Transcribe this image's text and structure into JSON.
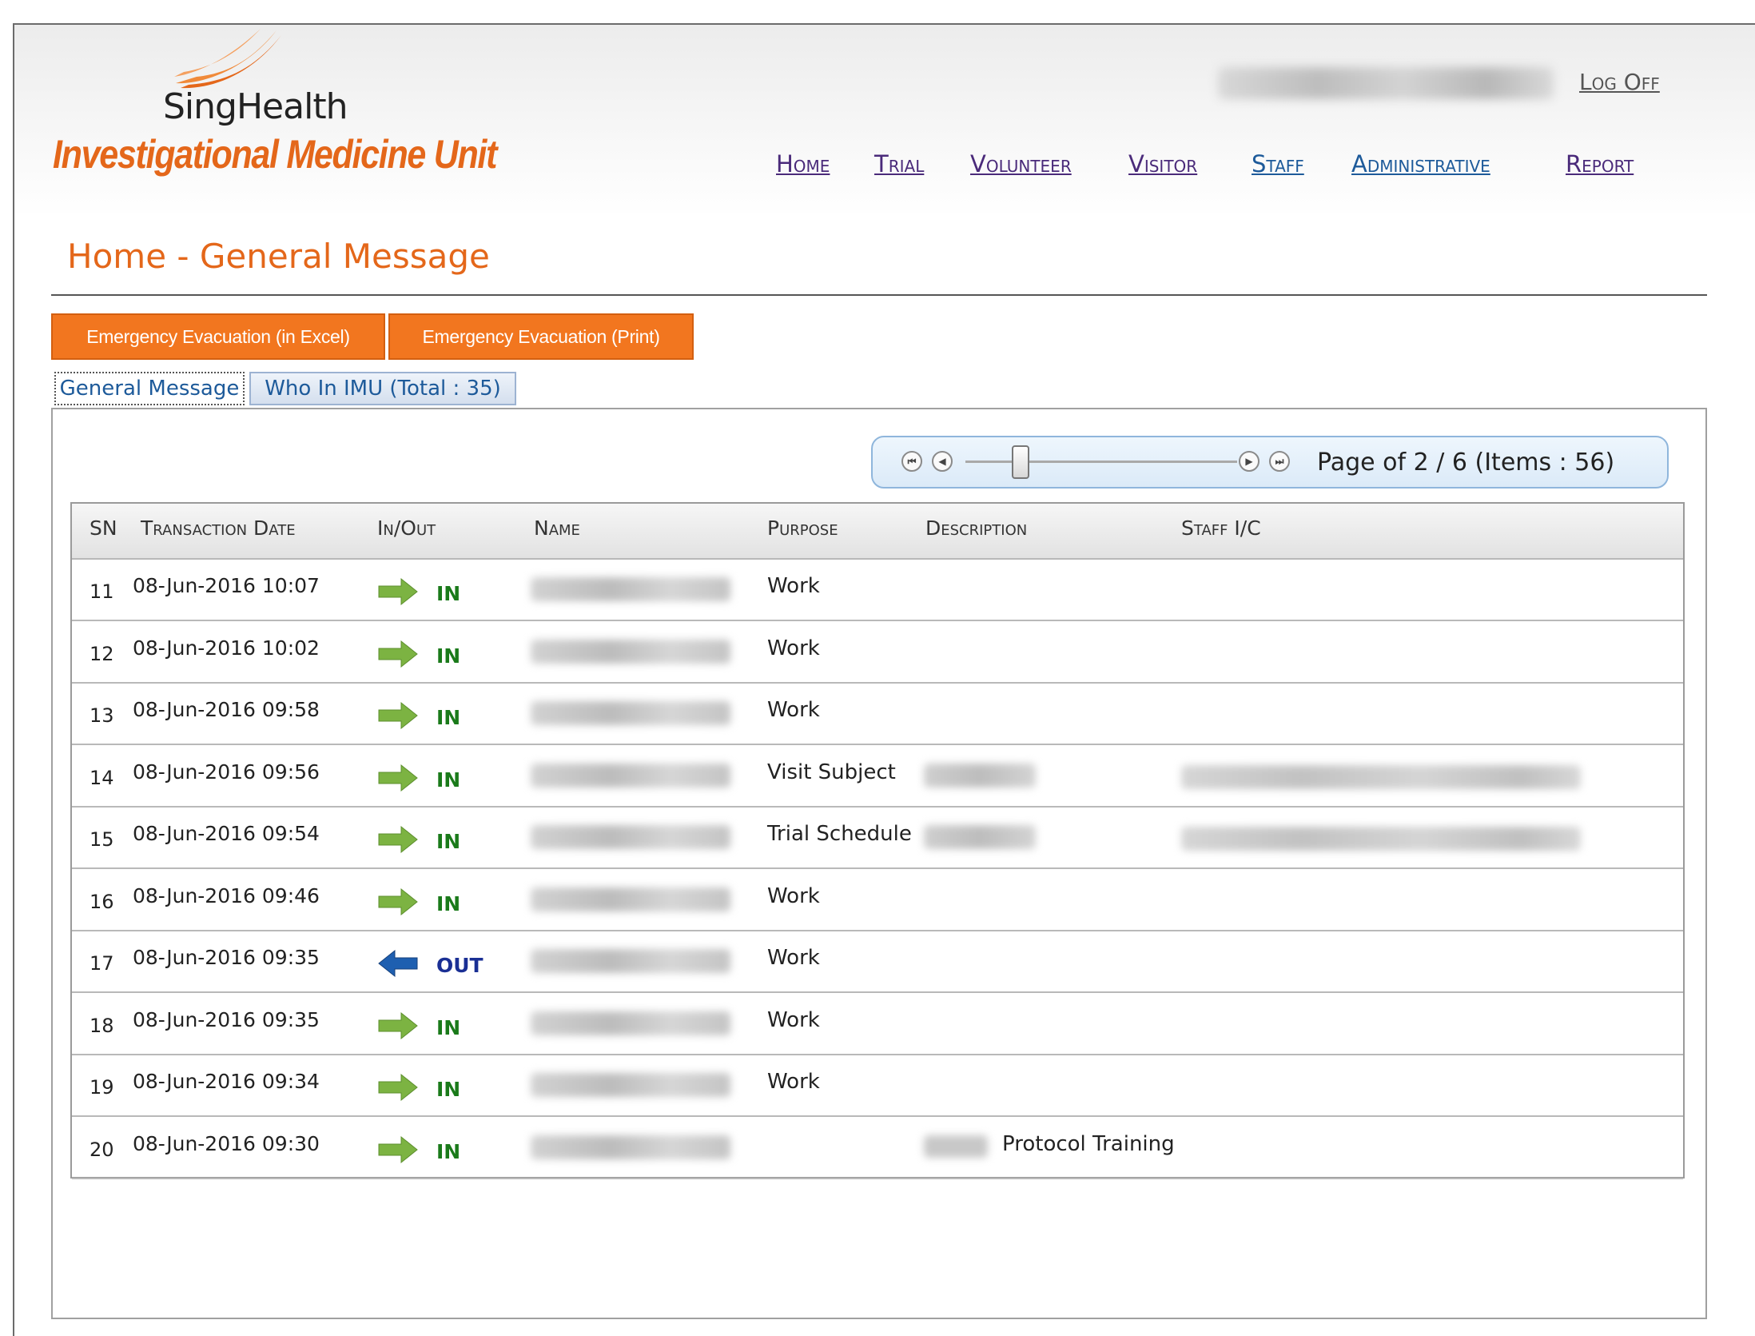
{
  "header": {
    "brand": "SingHealth",
    "unit": "Investigational Medicine Unit",
    "logoff_label": "Log Off"
  },
  "nav": {
    "items": [
      {
        "label": "Home",
        "color": "#4a2a7a"
      },
      {
        "label": "Trial",
        "color": "#4a2a7a"
      },
      {
        "label": "Volunteer",
        "color": "#4a2a7a"
      },
      {
        "label": "Visitor",
        "color": "#4a2a7a"
      },
      {
        "label": "Staff",
        "color": "#1d5a9a"
      },
      {
        "label": "Administrative",
        "color": "#1d5a9a"
      },
      {
        "label": "Report",
        "color": "#4a2a7a"
      }
    ]
  },
  "page": {
    "title": "Home - General Message"
  },
  "actions": {
    "excel_label": "Emergency Evacuation (in Excel)",
    "print_label": "Emergency Evacuation (Print)"
  },
  "tabs": [
    {
      "label": "General Message",
      "active": true
    },
    {
      "label": "Who In IMU (Total : 35)",
      "active": false
    }
  ],
  "pager": {
    "text": "Page of 2 / 6 (Items : 56)",
    "current_page": 2,
    "total_pages": 6,
    "total_items": 56
  },
  "table": {
    "columns": [
      "SN",
      "Transaction Date",
      "In/Out",
      "Name",
      "Purpose",
      "Description",
      "Staff I/C"
    ],
    "rows": [
      {
        "sn": "11",
        "date": "08-Jun-2016 10:07",
        "io": "IN",
        "purpose": "Work",
        "description": "",
        "staff_blur": false,
        "desc_blur": false
      },
      {
        "sn": "12",
        "date": "08-Jun-2016 10:02",
        "io": "IN",
        "purpose": "Work",
        "description": "",
        "staff_blur": false,
        "desc_blur": false
      },
      {
        "sn": "13",
        "date": "08-Jun-2016 09:58",
        "io": "IN",
        "purpose": "Work",
        "description": "",
        "staff_blur": false,
        "desc_blur": false
      },
      {
        "sn": "14",
        "date": "08-Jun-2016 09:56",
        "io": "IN",
        "purpose": "Visit Subject",
        "description": "",
        "staff_blur": true,
        "desc_blur": true
      },
      {
        "sn": "15",
        "date": "08-Jun-2016 09:54",
        "io": "IN",
        "purpose": "Trial Schedule",
        "description": "",
        "staff_blur": true,
        "desc_blur": true
      },
      {
        "sn": "16",
        "date": "08-Jun-2016 09:46",
        "io": "IN",
        "purpose": "Work",
        "description": "",
        "staff_blur": false,
        "desc_blur": false
      },
      {
        "sn": "17",
        "date": "08-Jun-2016 09:35",
        "io": "OUT",
        "purpose": "Work",
        "description": "",
        "staff_blur": false,
        "desc_blur": false
      },
      {
        "sn": "18",
        "date": "08-Jun-2016 09:35",
        "io": "IN",
        "purpose": "Work",
        "description": "",
        "staff_blur": false,
        "desc_blur": false
      },
      {
        "sn": "19",
        "date": "08-Jun-2016 09:34",
        "io": "IN",
        "purpose": "Work",
        "description": "",
        "staff_blur": false,
        "desc_blur": false
      },
      {
        "sn": "20",
        "date": "08-Jun-2016 09:30",
        "io": "IN",
        "purpose": "",
        "description": "Protocol Training",
        "staff_blur": false,
        "desc_blur": true
      }
    ]
  },
  "colors": {
    "accent_orange": "#e4671a",
    "button_orange": "#f2761f",
    "in_green": "#1a7a1a",
    "out_blue": "#1a2f94",
    "arrow_green": "#7cb342",
    "arrow_blue": "#1e5fb0"
  },
  "icons": {
    "in": "arrow-right-icon",
    "out": "arrow-left-icon"
  }
}
